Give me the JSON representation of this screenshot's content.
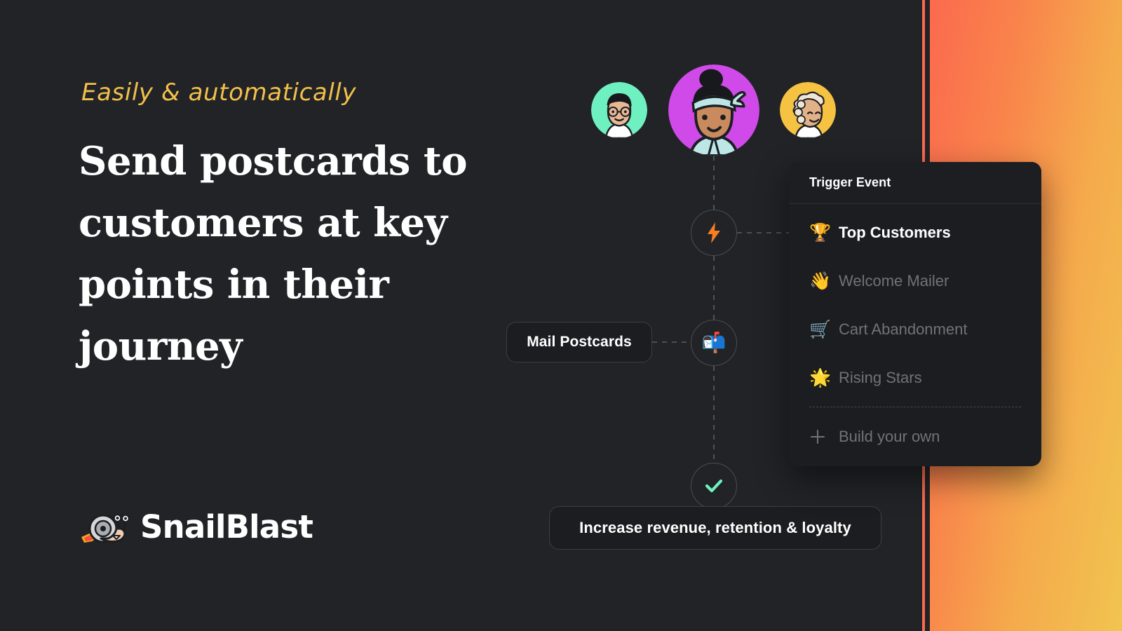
{
  "hero": {
    "eyebrow": "Easily & automatically",
    "headline": "Send postcards to customers at key points in their journey"
  },
  "brand": {
    "name": "SnailBlast",
    "logo_icon": "rocket-snail-icon"
  },
  "colors": {
    "background": "#212326",
    "eyebrow_yellow": "#f2bf4a",
    "accent_orange": "#fb6a4e",
    "accent_yellow": "#f1c44f",
    "mint": "#6ef2c0",
    "avatar_left_bg": "#6ff0c1",
    "avatar_center_bg": "#cf4ae8",
    "avatar_right_bg": "#f5c242",
    "panel_bg": "#1b1d20",
    "panel_header_bg": "#1c1e22",
    "muted_text": "#6f7378",
    "node_border": "#4a4d52"
  },
  "flow": {
    "avatars": [
      {
        "name": "customer-avatar-left",
        "bg": "#6ff0c1"
      },
      {
        "name": "customer-avatar-center",
        "bg": "#cf4ae8"
      },
      {
        "name": "customer-avatar-right",
        "bg": "#f5c242"
      }
    ],
    "nodes": [
      {
        "name": "trigger-node",
        "icon": "lightning-bolt-icon"
      },
      {
        "name": "mail-node",
        "icon": "mailbox-icon",
        "glyph": "📬"
      },
      {
        "name": "done-node",
        "icon": "check-icon"
      }
    ],
    "mail_chip_label": "Mail Postcards",
    "outcome_chip_label": "Increase revenue, retention & loyalty"
  },
  "trigger_panel": {
    "title": "Trigger Event",
    "items": [
      {
        "label": "Top Customers",
        "emoji": "🏆",
        "icon": "trophy-icon",
        "selected": true
      },
      {
        "label": "Welcome Mailer",
        "emoji": "👋",
        "icon": "waving-hand-icon",
        "selected": false
      },
      {
        "label": "Cart Abandonment",
        "emoji": "🛒",
        "icon": "shopping-cart-icon",
        "selected": false
      },
      {
        "label": "Rising Stars",
        "emoji": "🌟",
        "icon": "glowing-star-icon",
        "selected": false
      }
    ],
    "build_own_label": "Build your own",
    "build_own_icon": "plus-icon"
  }
}
